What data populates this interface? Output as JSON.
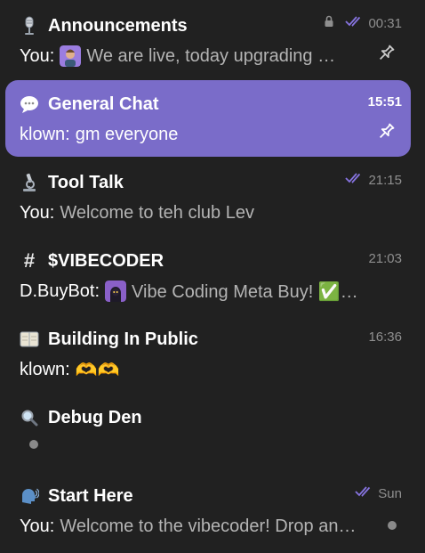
{
  "chats": [
    {
      "title": "Announcements",
      "icon": "microphone-icon",
      "time": "00:31",
      "muted_lock": true,
      "read_status": "double-check",
      "sender": "You",
      "message": "We are live, today upgrading …",
      "pinned": true
    },
    {
      "title": "General Chat",
      "icon": "speech-bubble-icon",
      "time": "15:51",
      "sender": "klown",
      "message": "gm everyone",
      "pinned": true,
      "active": true
    },
    {
      "title": "Tool Talk",
      "icon": "microscope-icon",
      "time": "21:15",
      "read_status": "double-check",
      "sender": "You",
      "message": "Welcome to teh club Lev"
    },
    {
      "title": "$VIBECODER",
      "icon": "hash-icon",
      "time": "21:03",
      "sender": "D.BuyBot",
      "message": "Vibe Coding Meta Buy! ✅✅…"
    },
    {
      "title": "Building In Public",
      "icon": "notebook-icon",
      "time": "16:36",
      "sender": "klown",
      "message": "🫶🫶"
    },
    {
      "title": "Debug Den",
      "icon": "magnifier-icon",
      "time": "",
      "sender": "",
      "message": ""
    },
    {
      "title": "Start Here",
      "icon": "speaking-head-icon",
      "time": "Sun",
      "read_status": "double-check",
      "sender": "You",
      "message": "Welcome to the vibecoder! Drop an…"
    }
  ],
  "labels": {
    "hash_symbol": "#",
    "colon": ":"
  },
  "colors": {
    "background": "#212121",
    "active": "#7a6cc9",
    "accent_check": "#8774e1",
    "muted_text": "#8f8f8f"
  }
}
